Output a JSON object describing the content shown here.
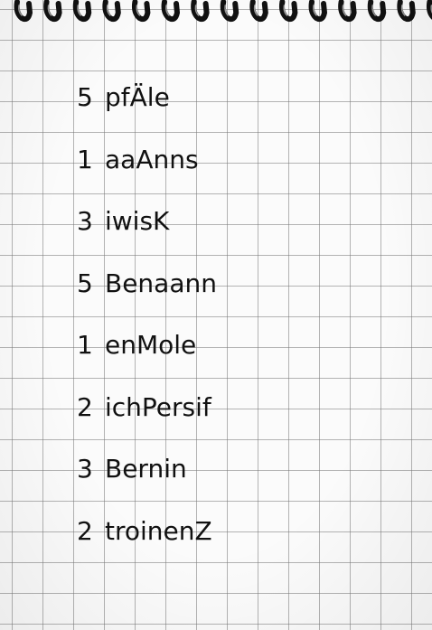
{
  "entries": [
    {
      "qty": "5",
      "word": "pfÄle"
    },
    {
      "qty": "1",
      "word": "aaAnns"
    },
    {
      "qty": "3",
      "word": "iwisK"
    },
    {
      "qty": "5",
      "word": "Benaann"
    },
    {
      "qty": "1",
      "word": "enMole"
    },
    {
      "qty": "2",
      "word": "ichPersif"
    },
    {
      "qty": "3",
      "word": "Bernin"
    },
    {
      "qty": "2",
      "word": "troinenZ"
    }
  ],
  "binding_icon": "spiral-binding-icon"
}
